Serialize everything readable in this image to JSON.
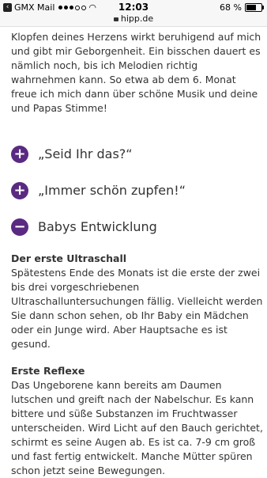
{
  "status_bar": {
    "carrier": "GMX Mail",
    "time": "12:03",
    "url": "hipp.de",
    "battery_percent": "68 %",
    "battery_level": 0.68
  },
  "intro_paragraph": "Klopfen deines Herzens wirkt beruhigend auf mich und gibt mir Geborgenheit. Ein bisschen dauert es nämlich noch, bis ich Melodien richtig wahrnehmen kann. So etwa ab dem 6. Monat freue ich mich dann über schöne Musik und deine und Papas Stimme!",
  "accordion": [
    {
      "label": "„Seid Ihr das?“",
      "icon": "plus-icon",
      "symbol": "+",
      "expanded": false
    },
    {
      "label": "„Immer schön zupfen!“",
      "icon": "plus-icon",
      "symbol": "+",
      "expanded": false
    },
    {
      "label": "Babys Entwicklung",
      "icon": "minus-icon",
      "symbol": "−",
      "expanded": true
    }
  ],
  "sections": [
    {
      "title": "Der erste Ultraschall",
      "text": "Spätestens Ende des Monats ist die erste der zwei bis drei vorgeschriebenen Ultraschalluntersuchungen fällig. Vielleicht werden Sie dann schon sehen, ob Ihr Baby ein Mädchen oder ein Junge wird. Aber Hauptsache es ist gesund."
    },
    {
      "title": "Erste Reflexe",
      "text": "Das Ungeborene kann bereits am Daumen lutschen und greift nach der Nabelschur. Es kann bittere und süße Substanzen im Fruchtwasser unterscheiden. Wird Licht auf den Bauch gerichtet, schirmt es seine Augen ab. Es ist ca. 7-9 cm groß und fast fertig entwickelt. Manche Mütter spüren schon jetzt seine Bewegungen."
    }
  ],
  "colors": {
    "accent": "#5a2a82",
    "text": "#333333",
    "statusbar_bg": "#f7f7f7"
  }
}
